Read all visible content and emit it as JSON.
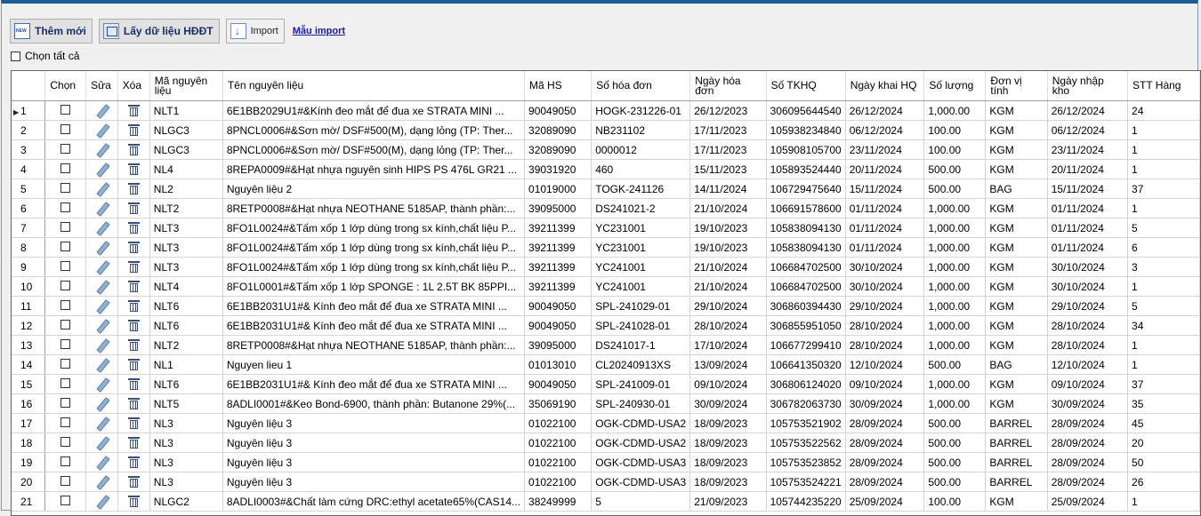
{
  "toolbar": {
    "add_new": "Thêm mới",
    "get_invoice": "Lấy dữ liệu HĐĐT",
    "import": "Import",
    "import_template": "Mẫu import"
  },
  "select_all_label": "Chọn tất cả",
  "columns": [
    "Chọn",
    "Sửa",
    "Xóa",
    "Mã nguyên liệu",
    "Tên nguyên liệu",
    "Mã HS",
    "Số hóa đơn",
    "Ngày hóa đơn",
    "Số TKHQ",
    "Ngày khai HQ",
    "Số lượng",
    "Đơn vị tính",
    "Ngày nhập kho",
    "STT Hàng"
  ],
  "rows": [
    {
      "stt": "1",
      "ma": "NLT1",
      "ten": "6E1BB2029U1#&Kính đeo mắt để đua xe STRATA MINI ...",
      "hs": "90049050",
      "hoadon": "HOGK-231226-01",
      "ngayhd": "26/12/2023",
      "tkhq": "306095644540",
      "ngaykhai": "26/12/2024",
      "sl": "1,000.00",
      "dvt": "KGM",
      "ngaynhap": "26/12/2024",
      "stthang": "24"
    },
    {
      "stt": "2",
      "ma": "NLGC3",
      "ten": "8PNCL0006#&Sơn mờ/ DSF#500(M), dạng lỏng (TP: Ther...",
      "hs": "32089090",
      "hoadon": "NB231102",
      "ngayhd": "17/11/2023",
      "tkhq": "105938234840",
      "ngaykhai": "06/12/2024",
      "sl": "100.00",
      "dvt": "KGM",
      "ngaynhap": "06/12/2024",
      "stthang": "1"
    },
    {
      "stt": "3",
      "ma": "NLGC3",
      "ten": "8PNCL0006#&Sơn mờ/ DSF#500(M), dạng lỏng (TP: Ther...",
      "hs": "32089090",
      "hoadon": "0000012",
      "ngayhd": "17/11/2023",
      "tkhq": "105908105700",
      "ngaykhai": "23/11/2024",
      "sl": "100.00",
      "dvt": "KGM",
      "ngaynhap": "23/11/2024",
      "stthang": "1"
    },
    {
      "stt": "4",
      "ma": "NL4",
      "ten": "8REPA0009#&Hạt nhựa nguyên sinh HIPS PS 476L GR21 ...",
      "hs": "39031920",
      "hoadon": "460",
      "ngayhd": "15/11/2023",
      "tkhq": "105893524440",
      "ngaykhai": "20/11/2024",
      "sl": "500.00",
      "dvt": "KGM",
      "ngaynhap": "20/11/2024",
      "stthang": "1"
    },
    {
      "stt": "5",
      "ma": "NL2",
      "ten": "Nguyên liệu 2",
      "hs": "01019000",
      "hoadon": "TOGK-241126",
      "ngayhd": "14/11/2024",
      "tkhq": "106729475640",
      "ngaykhai": "15/11/2024",
      "sl": "500.00",
      "dvt": "BAG",
      "ngaynhap": "15/11/2024",
      "stthang": "37"
    },
    {
      "stt": "6",
      "ma": "NLT2",
      "ten": "8RETP0008#&Hạt nhựa NEOTHANE 5185AP, thành phần:...",
      "hs": "39095000",
      "hoadon": "DS241021-2",
      "ngayhd": "21/10/2024",
      "tkhq": "106691578600",
      "ngaykhai": "01/11/2024",
      "sl": "1,000.00",
      "dvt": "KGM",
      "ngaynhap": "01/11/2024",
      "stthang": "1"
    },
    {
      "stt": "7",
      "ma": "NLT3",
      "ten": "8FO1L0024#&Tấm xốp 1 lớp dùng trong sx kính,chất liệu P...",
      "hs": "39211399",
      "hoadon": "YC231001",
      "ngayhd": "19/10/2023",
      "tkhq": "105838094130",
      "ngaykhai": "01/11/2024",
      "sl": "1,000.00",
      "dvt": "KGM",
      "ngaynhap": "01/11/2024",
      "stthang": "5"
    },
    {
      "stt": "8",
      "ma": "NLT3",
      "ten": "8FO1L0024#&Tấm xốp 1 lớp dùng trong sx kính,chất liệu P...",
      "hs": "39211399",
      "hoadon": "YC231001",
      "ngayhd": "19/10/2023",
      "tkhq": "105838094130",
      "ngaykhai": "01/11/2024",
      "sl": "1,000.00",
      "dvt": "KGM",
      "ngaynhap": "01/11/2024",
      "stthang": "6"
    },
    {
      "stt": "9",
      "ma": "NLT3",
      "ten": "8FO1L0024#&Tấm xốp 1 lớp dùng trong sx kính,chất liệu P...",
      "hs": "39211399",
      "hoadon": "YC241001",
      "ngayhd": "21/10/2024",
      "tkhq": "106684702500",
      "ngaykhai": "30/10/2024",
      "sl": "1,000.00",
      "dvt": "KGM",
      "ngaynhap": "30/10/2024",
      "stthang": "3"
    },
    {
      "stt": "10",
      "ma": "NLT4",
      "ten": "8FO1L0001#&Tấm xốp 1 lớp SPONGE : 1L 2.5T BK 85PPI...",
      "hs": "39211399",
      "hoadon": "YC241001",
      "ngayhd": "21/10/2024",
      "tkhq": "106684702500",
      "ngaykhai": "30/10/2024",
      "sl": "1,000.00",
      "dvt": "KGM",
      "ngaynhap": "30/10/2024",
      "stthang": "1"
    },
    {
      "stt": "11",
      "ma": "NLT6",
      "ten": "6E1BB2031U1#& Kính đeo mắt để đua xe STRATA MINI ...",
      "hs": "90049050",
      "hoadon": "SPL-241029-01",
      "ngayhd": "29/10/2024",
      "tkhq": "306860394430",
      "ngaykhai": "29/10/2024",
      "sl": "1,000.00",
      "dvt": "KGM",
      "ngaynhap": "29/10/2024",
      "stthang": "5"
    },
    {
      "stt": "12",
      "ma": "NLT6",
      "ten": "6E1BB2031U1#& Kính đeo mắt để đua xe STRATA MINI ...",
      "hs": "90049050",
      "hoadon": "SPL-241028-01",
      "ngayhd": "28/10/2024",
      "tkhq": "306855951050",
      "ngaykhai": "28/10/2024",
      "sl": "1,000.00",
      "dvt": "KGM",
      "ngaynhap": "28/10/2024",
      "stthang": "34"
    },
    {
      "stt": "13",
      "ma": "NLT2",
      "ten": "8RETP0008#&Hạt nhựa NEOTHANE 5185AP, thành phần:...",
      "hs": "39095000",
      "hoadon": "DS241017-1",
      "ngayhd": "17/10/2024",
      "tkhq": "106677299410",
      "ngaykhai": "28/10/2024",
      "sl": "1,000.00",
      "dvt": "KGM",
      "ngaynhap": "28/10/2024",
      "stthang": "1"
    },
    {
      "stt": "14",
      "ma": "NL1",
      "ten": "Nguyen lieu 1",
      "hs": "01013010",
      "hoadon": "CL20240913XS",
      "ngayhd": "13/09/2024",
      "tkhq": "106641350320",
      "ngaykhai": "12/10/2024",
      "sl": "500.00",
      "dvt": "BAG",
      "ngaynhap": "12/10/2024",
      "stthang": "1"
    },
    {
      "stt": "15",
      "ma": "NLT6",
      "ten": "6E1BB2031U1#& Kính đeo mắt để đua xe STRATA MINI ...",
      "hs": "90049050",
      "hoadon": "SPL-241009-01",
      "ngayhd": "09/10/2024",
      "tkhq": "306806124020",
      "ngaykhai": "09/10/2024",
      "sl": "1,000.00",
      "dvt": "KGM",
      "ngaynhap": "09/10/2024",
      "stthang": "37"
    },
    {
      "stt": "16",
      "ma": "NLT5",
      "ten": "8ADLI0001#&Keo Bond-6900, thành phần: Butanone 29%(...",
      "hs": "35069190",
      "hoadon": "SPL-240930-01",
      "ngayhd": "30/09/2024",
      "tkhq": "306782063730",
      "ngaykhai": "30/09/2024",
      "sl": "1,000.00",
      "dvt": "KGM",
      "ngaynhap": "30/09/2024",
      "stthang": "35"
    },
    {
      "stt": "17",
      "ma": "NL3",
      "ten": "Nguyên liệu 3",
      "hs": "01022100",
      "hoadon": "OGK-CDMD-USA2",
      "ngayhd": "18/09/2023",
      "tkhq": "105753521902",
      "ngaykhai": "28/09/2024",
      "sl": "500.00",
      "dvt": "BARREL",
      "ngaynhap": "28/09/2024",
      "stthang": "45"
    },
    {
      "stt": "18",
      "ma": "NL3",
      "ten": "Nguyên liệu 3",
      "hs": "01022100",
      "hoadon": "OGK-CDMD-USA2",
      "ngayhd": "18/09/2023",
      "tkhq": "105753522562",
      "ngaykhai": "28/09/2024",
      "sl": "500.00",
      "dvt": "BARREL",
      "ngaynhap": "28/09/2024",
      "stthang": "20"
    },
    {
      "stt": "19",
      "ma": "NL3",
      "ten": "Nguyên liệu 3",
      "hs": "01022100",
      "hoadon": "OGK-CDMD-USA3",
      "ngayhd": "18/09/2023",
      "tkhq": "105753523852",
      "ngaykhai": "28/09/2024",
      "sl": "500.00",
      "dvt": "BARREL",
      "ngaynhap": "28/09/2024",
      "stthang": "50"
    },
    {
      "stt": "20",
      "ma": "NL3",
      "ten": "Nguyên liệu 3",
      "hs": "01022100",
      "hoadon": "OGK-CDMD-USA3",
      "ngayhd": "18/09/2023",
      "tkhq": "105753524221",
      "ngaykhai": "28/09/2024",
      "sl": "500.00",
      "dvt": "BARREL",
      "ngaynhap": "28/09/2024",
      "stthang": "26"
    },
    {
      "stt": "21",
      "ma": "NLGC2",
      "ten": "8ADLI0003#&Chất làm cứng DRC:ethyl acetate65%(CAS14...",
      "hs": "38249999",
      "hoadon": "5",
      "ngayhd": "21/09/2023",
      "tkhq": "105744235220",
      "ngaykhai": "25/09/2024",
      "sl": "100.00",
      "dvt": "KGM",
      "ngaynhap": "25/09/2024",
      "stthang": "1"
    }
  ]
}
